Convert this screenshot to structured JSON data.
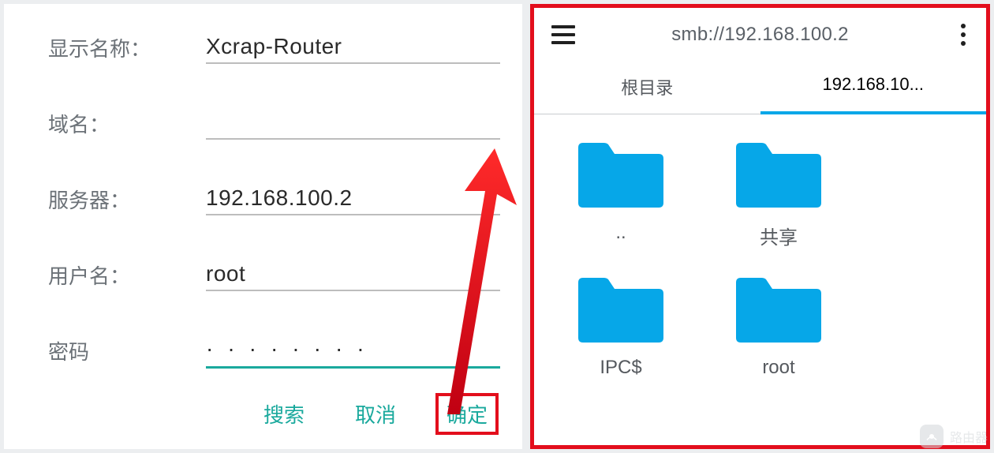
{
  "form": {
    "labels": {
      "display_name": "显示名称：",
      "domain": "域名：",
      "server": "服务器：",
      "username": "用户名：",
      "password": "密码"
    },
    "values": {
      "display_name": "Xcrap-Router",
      "domain": "",
      "server": "192.168.100.2",
      "username": "root",
      "password": "········"
    },
    "buttons": {
      "search": "搜索",
      "cancel": "取消",
      "ok": "确定"
    }
  },
  "browser": {
    "address": "smb://192.168.100.2",
    "tabs": {
      "root": "根目录",
      "ip": "192.168.10..."
    },
    "folders": {
      "up": "..",
      "share": "共享",
      "ipc": "IPC$",
      "root": "root"
    }
  },
  "watermark": {
    "text": "路由器"
  }
}
